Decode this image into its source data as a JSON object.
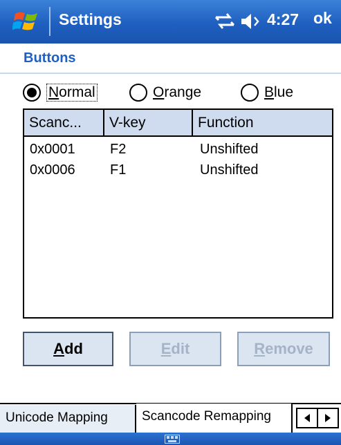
{
  "titlebar": {
    "app_title": "Settings",
    "time": "4:27",
    "ok_label": "ok"
  },
  "header": {
    "title": "Buttons"
  },
  "radios": [
    {
      "label": "Normal",
      "mnemonic": "N",
      "rest": "ormal",
      "selected": true
    },
    {
      "label": "Orange",
      "mnemonic": "O",
      "rest": "range",
      "selected": false
    },
    {
      "label": "Blue",
      "mnemonic": "B",
      "rest": "lue",
      "selected": false
    }
  ],
  "list": {
    "columns": [
      "Scanc...",
      "V-key",
      "Function"
    ],
    "rows": [
      [
        "0x0001",
        "F2",
        "Unshifted"
      ],
      [
        "0x0006",
        "F1",
        "Unshifted"
      ]
    ]
  },
  "buttons": {
    "add": {
      "label": "Add",
      "mnemonic": "A",
      "rest": "dd",
      "enabled": true
    },
    "edit": {
      "label": "Edit",
      "mnemonic": "E",
      "rest": "dit",
      "enabled": false
    },
    "remove": {
      "label": "Remove",
      "mnemonic": "R",
      "rest": "emove",
      "enabled": false
    }
  },
  "tabs": [
    {
      "label": "Unicode Mapping",
      "active": false
    },
    {
      "label": "Scancode Remapping",
      "active": true
    }
  ],
  "icons": {
    "start": "windows-flag-icon",
    "connectivity": "connectivity-icon",
    "volume": "speaker-icon",
    "scroll_left": "triangle-left-icon",
    "scroll_right": "triangle-right-icon",
    "keyboard": "keyboard-icon"
  },
  "colors": {
    "titlebar": "#1f5fbf",
    "accent": "#1f5fbf",
    "header_cell": "#cfdcef"
  }
}
